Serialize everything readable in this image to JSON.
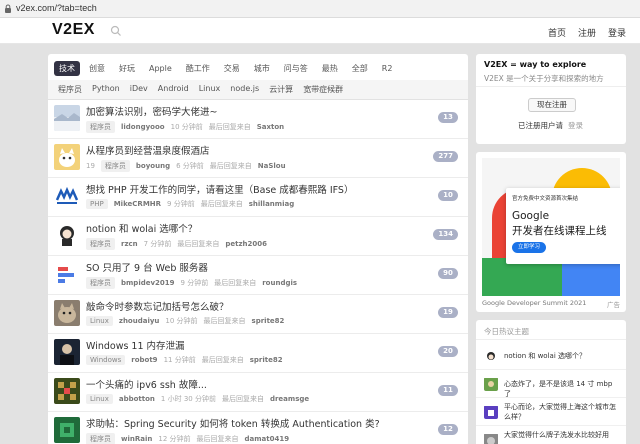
{
  "browser": {
    "url": "v2ex.com/?tab=tech"
  },
  "header": {
    "logo": "V2EX",
    "search_placeholder": "",
    "nav": [
      "首页",
      "注册",
      "登录"
    ]
  },
  "tabs": [
    "技术",
    "创意",
    "好玩",
    "Apple",
    "酷工作",
    "交易",
    "城市",
    "问与答",
    "最热",
    "全部",
    "R2"
  ],
  "active_tab": "技术",
  "subtabs": [
    "程序员",
    "Python",
    "iDev",
    "Android",
    "Linux",
    "node.js",
    "云计算",
    "宽带症候群"
  ],
  "topics": [
    {
      "title": "加密算法识别，密码学大佬进~",
      "node": "程序员",
      "votes": "",
      "author": "lidongyooo",
      "time": "10 分钟前",
      "last_prefix": "最后回复来自",
      "last_reply": "Saxton",
      "count": "13"
    },
    {
      "title": "从程序员到经营温泉度假酒店",
      "node": "程序员",
      "votes": "19",
      "author": "boyoung",
      "time": "6 分钟前",
      "last_prefix": "最后回复来自",
      "last_reply": "NaSlou",
      "count": "277"
    },
    {
      "title": "想找 PHP 开发工作的同学，请看这里（Base 成都春熙路 IFS）",
      "node": "PHP",
      "votes": "",
      "author": "MikeCRMHR",
      "time": "9 分钟前",
      "last_prefix": "最后回复来自",
      "last_reply": "shillanmiag",
      "count": "10"
    },
    {
      "title": "notion 和 wolai 选哪个？",
      "node": "程序员",
      "votes": "",
      "author": "rzcn",
      "time": "7 分钟前",
      "last_prefix": "最后回复来自",
      "last_reply": "petzh2006",
      "count": "134"
    },
    {
      "title": "SO 只用了 9 台 Web 服务器",
      "node": "程序员",
      "votes": "",
      "author": "bmpidev2019",
      "time": "9 分钟前",
      "last_prefix": "最后回复来自",
      "last_reply": "roundgis",
      "count": "90"
    },
    {
      "title": "敲命令时参数忘记加括号怎么破？",
      "node": "Linux",
      "votes": "",
      "author": "zhoudaiyu",
      "time": "10 分钟前",
      "last_prefix": "最后回复来自",
      "last_reply": "sprite82",
      "count": "19"
    },
    {
      "title": "Windows 11 内存泄漏",
      "node": "Windows",
      "votes": "",
      "author": "robot9",
      "time": "11 分钟前",
      "last_prefix": "最后回复来自",
      "last_reply": "sprite82",
      "count": "20"
    },
    {
      "title": "一个头痛的 ipv6 ssh 故障...",
      "node": "Linux",
      "votes": "",
      "author": "abbotton",
      "time": "1 小时 30 分钟前",
      "last_prefix": "最后回复来自",
      "last_reply": "dreamsge",
      "count": "11"
    },
    {
      "title": "求助帖：Spring Security 如何将 token 转换成 Authentication 类?",
      "node": "程序员",
      "votes": "",
      "author": "winRain",
      "time": "12 分钟前",
      "last_prefix": "最后回复来自",
      "last_reply": "damat0419",
      "count": "12"
    }
  ],
  "sidebar": {
    "intro_title": "V2EX = way to explore",
    "intro_text": "V2EX 是一个关于分享和探索的地方",
    "signup_button": "现在注册",
    "existing_user": "已注册用户请",
    "login_link": "登录",
    "ad": {
      "small": "官方免费中文资源首次集结",
      "headline1": "Google",
      "headline2": "开发者在线课程上线",
      "button": "立即学习",
      "caption": "Google Developer Summit 2021",
      "tag": "广告"
    },
    "hot_header": "今日热议主题",
    "hot_topics": [
      "notion 和 wolai 选哪个？",
      "心态炸了，是不是该退 14 寸 mbp 了",
      "平心而论，大家觉得上海这个城市怎么样？",
      "大家觉得什么牌子洗发水比较好用"
    ]
  },
  "colors": {
    "active_tab": "#333344",
    "count_badge": "#aab0c6",
    "page_bg": "#e2e2e2"
  }
}
